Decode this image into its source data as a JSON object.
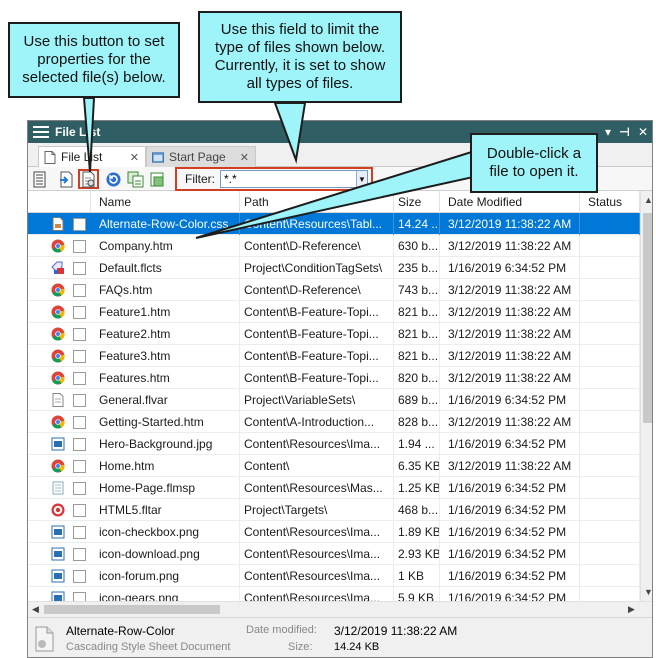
{
  "window": {
    "title": "File List",
    "controls": [
      "▾",
      "⊣",
      "✕"
    ]
  },
  "tabs": [
    {
      "label": "File List",
      "close": "✕",
      "active": true
    },
    {
      "label": "Start Page",
      "close": "✕",
      "active": false
    }
  ],
  "filter": {
    "label": "Filter:",
    "value": "*.*",
    "drop": "▼"
  },
  "columns": {
    "name": "Name",
    "path": "Path",
    "size": "Size",
    "modified": "Date Modified",
    "status": "Status"
  },
  "rows": [
    {
      "icon": "css-file-icon",
      "name": "Alternate-Row-Color.css",
      "path": "Content\\Resources\\Tabl...",
      "size": "14.24 ...",
      "modified": "3/12/2019 11:38:22 AM",
      "selected": true
    },
    {
      "icon": "chrome-icon",
      "name": "Company.htm",
      "path": "Content\\D-Reference\\",
      "size": "630 b...",
      "modified": "3/12/2019 11:38:22 AM"
    },
    {
      "icon": "condition-tag-icon",
      "name": "Default.flcts",
      "path": "Project\\ConditionTagSets\\",
      "size": "235 b...",
      "modified": "1/16/2019 6:34:52 PM"
    },
    {
      "icon": "chrome-icon",
      "name": "FAQs.htm",
      "path": "Content\\D-Reference\\",
      "size": "743 b...",
      "modified": "3/12/2019 11:38:22 AM"
    },
    {
      "icon": "chrome-icon",
      "name": "Feature1.htm",
      "path": "Content\\B-Feature-Topi...",
      "size": "821 b...",
      "modified": "3/12/2019 11:38:22 AM"
    },
    {
      "icon": "chrome-icon",
      "name": "Feature2.htm",
      "path": "Content\\B-Feature-Topi...",
      "size": "821 b...",
      "modified": "3/12/2019 11:38:22 AM"
    },
    {
      "icon": "chrome-icon",
      "name": "Feature3.htm",
      "path": "Content\\B-Feature-Topi...",
      "size": "821 b...",
      "modified": "3/12/2019 11:38:22 AM"
    },
    {
      "icon": "chrome-icon",
      "name": "Features.htm",
      "path": "Content\\B-Feature-Topi...",
      "size": "820 b...",
      "modified": "3/12/2019 11:38:22 AM"
    },
    {
      "icon": "variable-file-icon",
      "name": "General.flvar",
      "path": "Project\\VariableSets\\",
      "size": "689 b...",
      "modified": "1/16/2019 6:34:52 PM"
    },
    {
      "icon": "chrome-icon",
      "name": "Getting-Started.htm",
      "path": "Content\\A-Introduction...",
      "size": "828 b...",
      "modified": "3/12/2019 11:38:22 AM"
    },
    {
      "icon": "image-file-icon",
      "name": "Hero-Background.jpg",
      "path": "Content\\Resources\\Ima...",
      "size": "1.94 ...",
      "modified": "1/16/2019 6:34:52 PM"
    },
    {
      "icon": "chrome-icon",
      "name": "Home.htm",
      "path": "Content\\",
      "size": "6.35 KB",
      "modified": "3/12/2019 11:38:22 AM"
    },
    {
      "icon": "masterpage-file-icon",
      "name": "Home-Page.flmsp",
      "path": "Content\\Resources\\Mas...",
      "size": "1.25 KB",
      "modified": "1/16/2019 6:34:52 PM"
    },
    {
      "icon": "target-file-icon",
      "name": "HTML5.fltar",
      "path": "Project\\Targets\\",
      "size": "468 b...",
      "modified": "1/16/2019 6:34:52 PM"
    },
    {
      "icon": "image-file-icon",
      "name": "icon-checkbox.png",
      "path": "Content\\Resources\\Ima...",
      "size": "1.89 KB",
      "modified": "1/16/2019 6:34:52 PM"
    },
    {
      "icon": "image-file-icon",
      "name": "icon-download.png",
      "path": "Content\\Resources\\Ima...",
      "size": "2.93 KB",
      "modified": "1/16/2019 6:34:52 PM"
    },
    {
      "icon": "image-file-icon",
      "name": "icon-forum.png",
      "path": "Content\\Resources\\Ima...",
      "size": "1 KB",
      "modified": "1/16/2019 6:34:52 PM"
    },
    {
      "icon": "image-file-icon",
      "name": "icon-gears.png",
      "path": "Content\\Resources\\Ima...",
      "size": "5.9 KB",
      "modified": "1/16/2019 6:34:52 PM"
    }
  ],
  "details": {
    "name": "Alternate-Row-Color",
    "type": "Cascading Style Sheet Document",
    "modified_label": "Date modified:",
    "modified_value": "3/12/2019 11:38:22 AM",
    "size_label": "Size:",
    "size_value": "14.24 KB"
  },
  "scroll": {
    "left": "◀",
    "right": "▶",
    "up": "▲",
    "down": "▼"
  },
  "callouts": {
    "properties": "Use this button to set properties for the selected file(s) below.",
    "filter": "Use this field to limit the type of files shown below. Currently, it is set to show all types of files.",
    "open": "Double-click a file to open it."
  },
  "colors": {
    "titlebar": "#2f5e65",
    "selection": "#0078d7",
    "callout": "#9ef4f8",
    "highlight": "#d04020"
  }
}
